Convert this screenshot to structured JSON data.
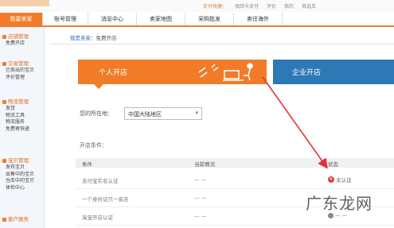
{
  "top_links": [
    "支付快捷：",
    "找回卡支付",
    "评价",
    "我的",
    "首选车"
  ],
  "nav": {
    "tabs": [
      "我要卖家",
      "账号管理",
      "消息中心",
      "卖家地图",
      "采购批发",
      "卖往海外"
    ],
    "active_index": 0
  },
  "sidebar": {
    "groups": [
      {
        "title": "店铺管理",
        "items": [
          "免费开店"
        ]
      },
      {
        "title": "交易管理",
        "items": [
          "已卖出的宝贝",
          "评价管理"
        ]
      },
      {
        "title": "物流管理",
        "items": [
          "发货",
          "物流工具",
          "物流服务",
          "免费寄快递"
        ]
      },
      {
        "title": "宝贝管理",
        "items": [
          "发布宝贝",
          "出售中的宝贝",
          "仓库中的宝贝",
          "体检中心"
        ]
      },
      {
        "title": "客户服务",
        "items": []
      }
    ]
  },
  "breadcrumb": {
    "home": "我是卖家",
    "separator": "：",
    "current": "免费开店"
  },
  "cards": {
    "personal": "个人开店",
    "business": "企业开店"
  },
  "region": {
    "label": "您的所在地：",
    "value": "中国大陆地区"
  },
  "conditions": {
    "title": "开店条件：",
    "headers": [
      "条件",
      "当前情况",
      "状态"
    ],
    "rows": [
      {
        "condition": "支付宝实名认证",
        "current": "— —",
        "status": "未认证",
        "status_type": "error"
      },
      {
        "condition": "一个身份证只一家店",
        "current": "— —",
        "status": "",
        "status_type": "none"
      },
      {
        "condition": "淘宝开店认证",
        "current": "— —",
        "status": "— —",
        "status_type": "pending"
      }
    ]
  },
  "watermark": "广东龙网",
  "colors": {
    "accent": "#f07c2a",
    "business_blue": "#2d78b5",
    "arrow": "#e8303a"
  }
}
